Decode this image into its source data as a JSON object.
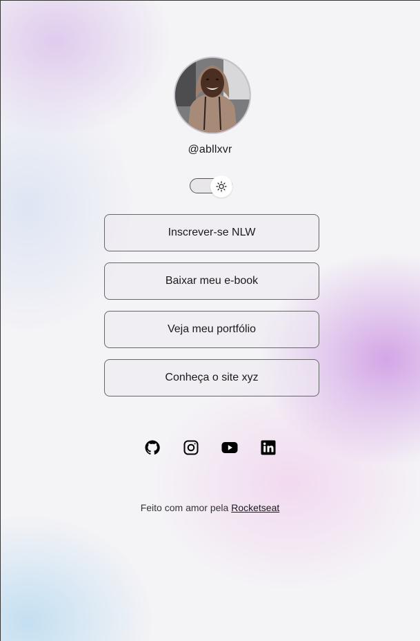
{
  "profile": {
    "handle": "@abllxvr",
    "avatar_alt": "Foto de perfil"
  },
  "theme_switch": {
    "icon": "sun-icon"
  },
  "links": [
    {
      "label": "Inscrever-se NLW"
    },
    {
      "label": "Baixar meu e-book"
    },
    {
      "label": "Veja meu portfólio"
    },
    {
      "label": "Conheça o site xyz"
    }
  ],
  "social": [
    {
      "icon": "github-icon"
    },
    {
      "icon": "instagram-icon"
    },
    {
      "icon": "youtube-icon"
    },
    {
      "icon": "linkedin-icon"
    }
  ],
  "footer": {
    "text": "Feito com amor pela ",
    "link_label": "Rocketseat"
  },
  "colors": {
    "background": "#f4f3f6",
    "accent_purple": "#c88ce1",
    "accent_blue": "#afd7f0",
    "text": "#1a1a1a"
  }
}
